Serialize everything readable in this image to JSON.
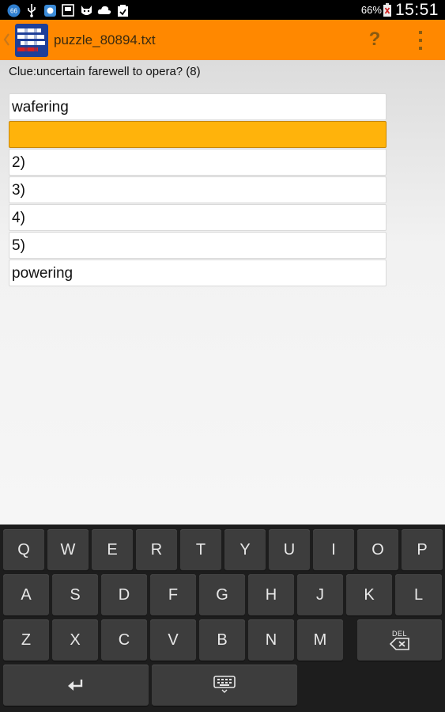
{
  "status_bar": {
    "battery_text": "66%",
    "time": "15:51",
    "icons": [
      "app-notification-icon",
      "usb-icon",
      "app-icon",
      "screenshot-icon",
      "cat-icon",
      "cloud-icon",
      "clipboard-check-icon"
    ]
  },
  "action_bar": {
    "title": "puzzle_80894.txt",
    "help_label": "?",
    "color": "#ff8800"
  },
  "clue": {
    "text": "Clue:uncertain farewell to opera? (8)"
  },
  "answers": [
    {
      "text": "wafering",
      "selected": false
    },
    {
      "text": "",
      "selected": true
    },
    {
      "text": "2)",
      "selected": false
    },
    {
      "text": "3)",
      "selected": false
    },
    {
      "text": "4)",
      "selected": false
    },
    {
      "text": "5)",
      "selected": false
    },
    {
      "text": "powering",
      "selected": false
    }
  ],
  "keyboard": {
    "row1": [
      "Q",
      "W",
      "E",
      "R",
      "T",
      "Y",
      "U",
      "I",
      "O",
      "P"
    ],
    "row2": [
      "A",
      "S",
      "D",
      "F",
      "G",
      "H",
      "J",
      "K",
      "L"
    ],
    "row3": [
      "Z",
      "X",
      "C",
      "V",
      "B",
      "N",
      "M"
    ],
    "del_label": "DEL"
  }
}
